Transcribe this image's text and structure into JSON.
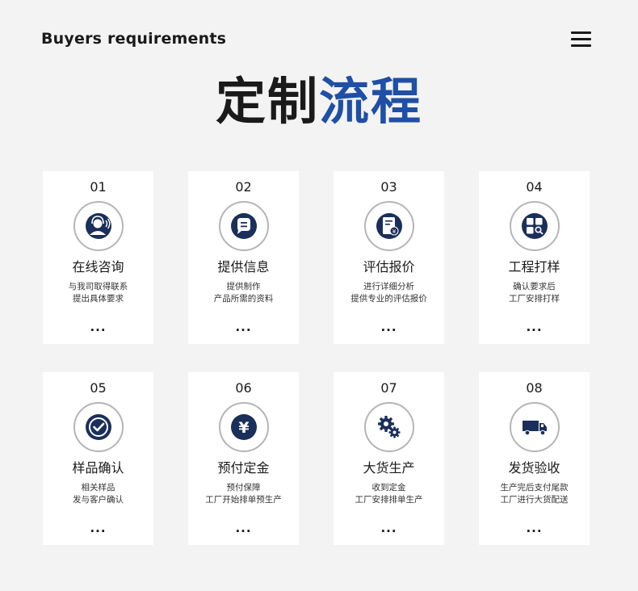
{
  "header": {
    "title": "Buyers requirements"
  },
  "page_title": {
    "part1": "定制",
    "part2": "流程"
  },
  "colors": {
    "accent_blue": "#1f4fa6",
    "icon_navy": "#1a2f5a",
    "background": "#f3f3f3"
  },
  "steps": [
    {
      "num": "01",
      "title": "在线咨询",
      "desc1": "与我司取得联系",
      "desc2": "提出具体要求",
      "more": "...",
      "icon": "customer-service-icon"
    },
    {
      "num": "02",
      "title": "提供信息",
      "desc1": "提供制作",
      "desc2": "产品所需的资料",
      "more": "...",
      "icon": "chat-bubble-icon"
    },
    {
      "num": "03",
      "title": "评估报价",
      "desc1": "进行详细分析",
      "desc2": "提供专业的评估报价",
      "more": "...",
      "icon": "quote-document-icon"
    },
    {
      "num": "04",
      "title": "工程打样",
      "desc1": "确认要求后",
      "desc2": "工厂安排打样",
      "more": "...",
      "icon": "grid-search-icon"
    },
    {
      "num": "05",
      "title": "样品确认",
      "desc1": "相关样品",
      "desc2": "发与客户确认",
      "more": "...",
      "icon": "check-circle-icon"
    },
    {
      "num": "06",
      "title": "预付定金",
      "desc1": "预付保障",
      "desc2": "工厂开始排单预生产",
      "more": "...",
      "icon": "yen-coin-icon"
    },
    {
      "num": "07",
      "title": "大货生产",
      "desc1": "收到定金",
      "desc2": "工厂安排排单生产",
      "more": "...",
      "icon": "gears-icon"
    },
    {
      "num": "08",
      "title": "发货验收",
      "desc1": "生产完后支付尾款",
      "desc2": "工厂进行大货配送",
      "more": "...",
      "icon": "delivery-truck-icon"
    }
  ]
}
